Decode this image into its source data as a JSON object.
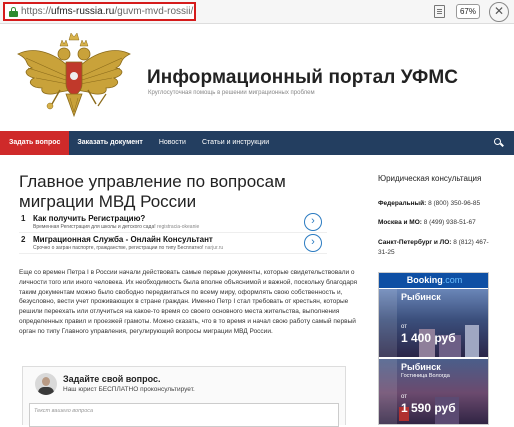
{
  "browser": {
    "url_prefix": "https://",
    "url_domain": "ufms-russia.ru",
    "url_path": "/guvm-mvd-rossii/",
    "zoom": "67%",
    "close_glyph": "✕"
  },
  "header": {
    "title": "Информационный портал УФМС",
    "tagline": "Круглосуточная помощь в решении миграционных проблем"
  },
  "nav": {
    "items": [
      {
        "label": "Задать вопрос",
        "active": true
      },
      {
        "label": "Заказать документ",
        "bold": true
      },
      {
        "label": "Новости"
      },
      {
        "label": "Статьи и инструкции"
      }
    ]
  },
  "main": {
    "heading": "Главное управление по вопросам миграции МВД России",
    "ads": [
      {
        "num": "1",
        "title": "Как получить Регистрацию?",
        "desc": "Временная Регистрация для школы и детского сада!",
        "site": "registracia-okeanie",
        "arrow": "›"
      },
      {
        "num": "2",
        "title": "Миграционная Служба - Онлайн Консультант",
        "desc": "Срочно о загран паспорте, гражданстве, регистрации по типу Бесплатно!",
        "site": "narjur.ru",
        "arrow": "›"
      }
    ],
    "article": "Еще со времен Петра I в России начали действовать самые первые документы, которые свидетельствовали о личности того или иного человека. Их необходимость была вполне объяснимой и важной, поскольку благодаря таким документам можно было свободно передвигаться по всему миру, оформлять свою собственность и, безусловно, вести учет проживающих в стране граждан. Именно Петр I стал требовать от крестьян, которые решили переехать или отлучиться на какое-то время со своего основного места жительства, выполнения определенных правил и проезжей грамоты. Можно сказать, что в то время и начал свою работу самый первый орган по типу Главного управления, регулирующий вопросы миграции МВД России.",
    "question": {
      "title": "Задайте свой вопрос.",
      "subtitle": "Наш юрист БЕСПЛАТНО проконсультирует.",
      "placeholder": "Текст вашего вопроса"
    }
  },
  "sidebar": {
    "title": "Юридическая консультация",
    "phones": [
      {
        "label": "Федеральный:",
        "number": "8 (800) 350-96-85"
      },
      {
        "label": "Москва и МО:",
        "number": "8 (499) 938-51-67"
      },
      {
        "label": "Санкт-Петербург и ЛО:",
        "number": "8 (812) 467-31-25"
      }
    ],
    "booking": {
      "brand": "Booking",
      "brand_suffix": ".com",
      "hotels": [
        {
          "city": "Рыбинск",
          "name": "",
          "from": "от",
          "price": "1 400 руб"
        },
        {
          "city": "Рыбинск",
          "name": "Гостиница Вологда",
          "from": "от",
          "price": "1 590 руб"
        }
      ]
    }
  }
}
